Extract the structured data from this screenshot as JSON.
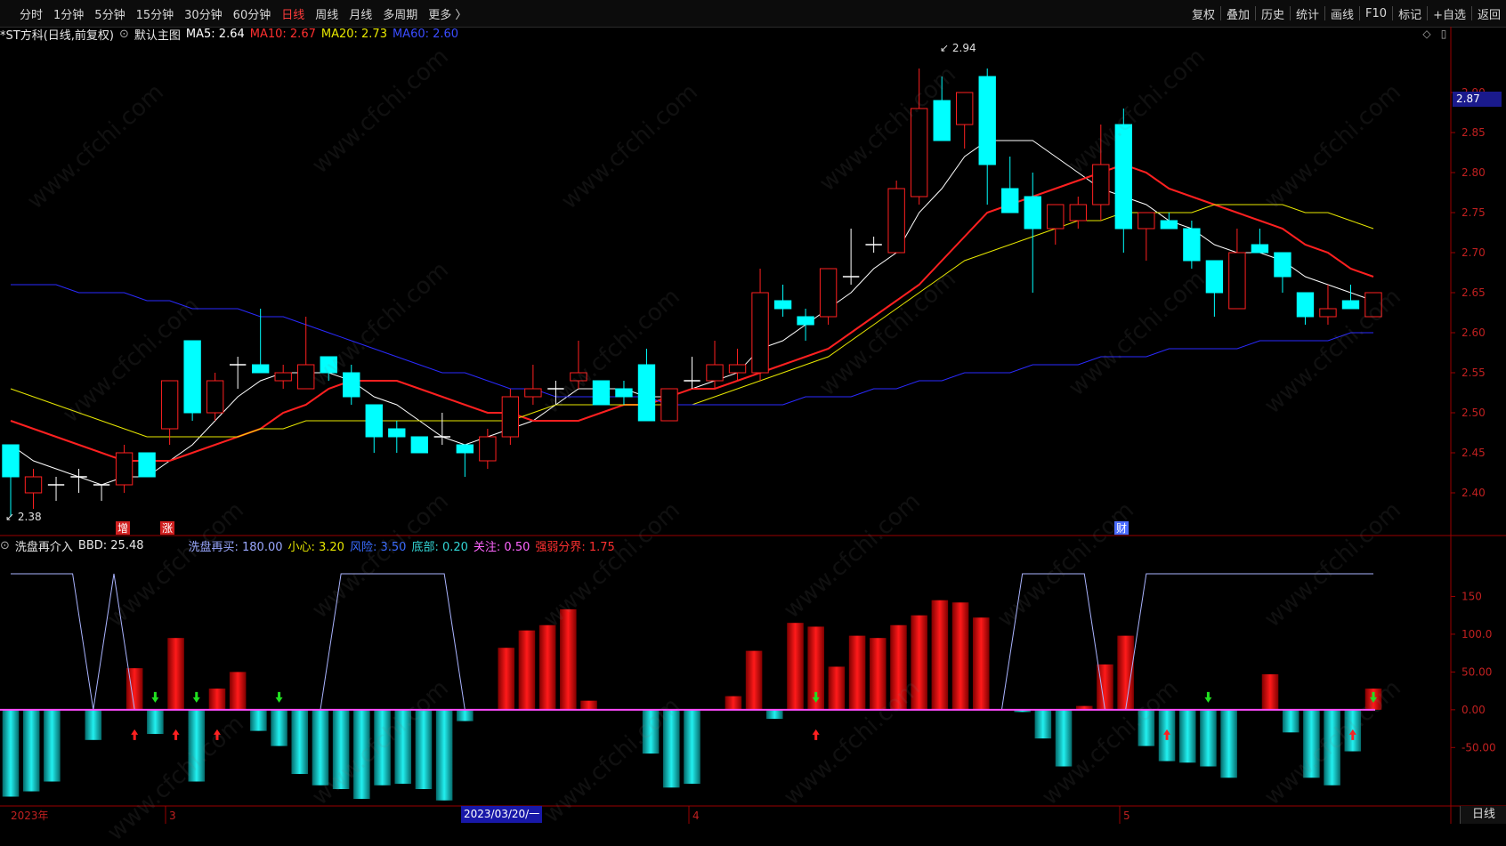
{
  "toolbar": {
    "periods": [
      "分时",
      "1分钟",
      "5分钟",
      "15分钟",
      "30分钟",
      "60分钟",
      "日线",
      "周线",
      "月线",
      "多周期",
      "更多 〉"
    ],
    "active_period": "日线",
    "right_buttons": [
      "复权",
      "叠加",
      "历史",
      "统计",
      "画线",
      "F10",
      "标记",
      "+自选",
      "返回"
    ]
  },
  "main_info": {
    "symbol": "*ST方科(日线,前复权)",
    "template": "默认主图",
    "ma5": {
      "label": "MA5: 2.64",
      "color": "#ffffff"
    },
    "ma10": {
      "label": "MA10: 2.67",
      "color": "#ff3030"
    },
    "ma20": {
      "label": "MA20: 2.73",
      "color": "#e8e800"
    },
    "ma60": {
      "label": "MA60: 2.60",
      "color": "#3030ff"
    }
  },
  "indicator_info": {
    "name": "洗盘再介入",
    "bbd": "BBD: 25.48",
    "items": [
      {
        "label": "洗盘再买: 180.00",
        "color": "#9aa8ff"
      },
      {
        "label": "小心: 3.20",
        "color": "#e8e800"
      },
      {
        "label": "风险: 3.50",
        "color": "#3a6cff"
      },
      {
        "label": "底部: 0.20",
        "color": "#33d6d6"
      },
      {
        "label": "关注: 0.50",
        "color": "#ff66ff"
      },
      {
        "label": "强弱分界: 1.75",
        "color": "#ff3030"
      }
    ]
  },
  "price_axis_labels": [
    "2.90",
    "2.85",
    "2.80",
    "2.75",
    "2.70",
    "2.65",
    "2.60",
    "2.55",
    "2.50",
    "2.45",
    "2.40"
  ],
  "ind_axis_labels": [
    "150",
    "100.0",
    "50.00",
    "0.00",
    "-50.00"
  ],
  "current_price": "2.87",
  "high_label": "2.94",
  "low_label": "2.38",
  "date_axis": {
    "year": "2023年",
    "m3": "3",
    "m4": "4",
    "m5": "5",
    "selected_date": "2023/03/20/一"
  },
  "event_markers": [
    "增",
    "涨",
    "财"
  ],
  "daily_button": "日线",
  "watermark": "www.cfchi.com",
  "colors": {
    "up": "#ff2020",
    "down": "#00ffff",
    "bar_up": "#d00000",
    "bar_down": "#10c0c0"
  },
  "chart_data": [
    {
      "type": "candlestick",
      "title": "*ST方科(日线,前复权)",
      "ylim": [
        2.36,
        2.96
      ],
      "candles": [
        [
          2.46,
          2.46,
          2.37,
          2.42
        ],
        [
          2.4,
          2.43,
          2.38,
          2.42
        ],
        [
          2.41,
          2.42,
          2.39,
          2.41
        ],
        [
          2.42,
          2.43,
          2.4,
          2.42
        ],
        [
          2.41,
          2.41,
          2.39,
          2.41
        ],
        [
          2.41,
          2.46,
          2.4,
          2.45
        ],
        [
          2.45,
          2.45,
          2.42,
          2.42
        ],
        [
          2.48,
          2.54,
          2.46,
          2.54
        ],
        [
          2.59,
          2.59,
          2.49,
          2.5
        ],
        [
          2.5,
          2.55,
          2.49,
          2.54
        ],
        [
          2.56,
          2.57,
          2.53,
          2.56
        ],
        [
          2.56,
          2.63,
          2.55,
          2.55
        ],
        [
          2.54,
          2.56,
          2.53,
          2.55
        ],
        [
          2.53,
          2.62,
          2.53,
          2.56
        ],
        [
          2.57,
          2.57,
          2.54,
          2.55
        ],
        [
          2.55,
          2.56,
          2.51,
          2.52
        ],
        [
          2.51,
          2.51,
          2.45,
          2.47
        ],
        [
          2.48,
          2.49,
          2.45,
          2.47
        ],
        [
          2.47,
          2.47,
          2.45,
          2.45
        ],
        [
          2.47,
          2.5,
          2.46,
          2.47
        ],
        [
          2.46,
          2.46,
          2.42,
          2.45
        ],
        [
          2.44,
          2.48,
          2.43,
          2.47
        ],
        [
          2.47,
          2.53,
          2.46,
          2.52
        ],
        [
          2.52,
          2.56,
          2.51,
          2.53
        ],
        [
          2.53,
          2.54,
          2.51,
          2.53
        ],
        [
          2.54,
          2.59,
          2.53,
          2.55
        ],
        [
          2.54,
          2.54,
          2.51,
          2.51
        ],
        [
          2.53,
          2.54,
          2.51,
          2.52
        ],
        [
          2.56,
          2.58,
          2.49,
          2.49
        ],
        [
          2.49,
          2.53,
          2.49,
          2.53
        ],
        [
          2.54,
          2.57,
          2.53,
          2.54
        ],
        [
          2.54,
          2.59,
          2.53,
          2.56
        ],
        [
          2.55,
          2.58,
          2.54,
          2.56
        ],
        [
          2.55,
          2.68,
          2.54,
          2.65
        ],
        [
          2.64,
          2.66,
          2.62,
          2.63
        ],
        [
          2.62,
          2.63,
          2.59,
          2.61
        ],
        [
          2.62,
          2.68,
          2.61,
          2.68
        ],
        [
          2.67,
          2.73,
          2.66,
          2.67
        ],
        [
          2.71,
          2.72,
          2.7,
          2.71
        ],
        [
          2.7,
          2.79,
          2.7,
          2.78
        ],
        [
          2.77,
          2.93,
          2.76,
          2.88
        ],
        [
          2.89,
          2.92,
          2.84,
          2.84
        ],
        [
          2.86,
          2.9,
          2.83,
          2.9
        ],
        [
          2.92,
          2.93,
          2.76,
          2.81
        ],
        [
          2.78,
          2.82,
          2.76,
          2.75
        ],
        [
          2.77,
          2.8,
          2.65,
          2.73
        ],
        [
          2.73,
          2.76,
          2.71,
          2.76
        ],
        [
          2.74,
          2.77,
          2.73,
          2.76
        ],
        [
          2.76,
          2.86,
          2.74,
          2.81
        ],
        [
          2.86,
          2.88,
          2.7,
          2.73
        ],
        [
          2.73,
          2.75,
          2.69,
          2.75
        ],
        [
          2.74,
          2.75,
          2.73,
          2.73
        ],
        [
          2.73,
          2.74,
          2.68,
          2.69
        ],
        [
          2.69,
          2.69,
          2.62,
          2.65
        ],
        [
          2.63,
          2.73,
          2.63,
          2.7
        ],
        [
          2.71,
          2.73,
          2.7,
          2.7
        ],
        [
          2.7,
          2.7,
          2.65,
          2.67
        ],
        [
          2.65,
          2.65,
          2.61,
          2.62
        ],
        [
          2.62,
          2.66,
          2.61,
          2.63
        ],
        [
          2.64,
          2.66,
          2.63,
          2.63
        ],
        [
          2.62,
          2.65,
          2.62,
          2.65
        ]
      ],
      "series": [
        {
          "name": "MA5",
          "values": [
            2.46,
            2.44,
            2.43,
            2.42,
            2.41,
            2.42,
            2.42,
            2.44,
            2.46,
            2.49,
            2.52,
            2.54,
            2.55,
            2.55,
            2.55,
            2.54,
            2.52,
            2.51,
            2.49,
            2.47,
            2.46,
            2.47,
            2.48,
            2.49,
            2.51,
            2.53,
            2.53,
            2.53,
            2.52,
            2.52,
            2.53,
            2.54,
            2.55,
            2.58,
            2.59,
            2.61,
            2.63,
            2.65,
            2.68,
            2.7,
            2.75,
            2.78,
            2.82,
            2.84,
            2.84,
            2.84,
            2.82,
            2.8,
            2.78,
            2.77,
            2.76,
            2.74,
            2.73,
            2.71,
            2.7,
            2.7,
            2.69,
            2.67,
            2.66,
            2.65,
            2.64
          ]
        },
        {
          "name": "MA10",
          "values": [
            2.49,
            2.48,
            2.47,
            2.46,
            2.45,
            2.44,
            2.44,
            2.44,
            2.45,
            2.46,
            2.47,
            2.48,
            2.5,
            2.51,
            2.53,
            2.54,
            2.54,
            2.54,
            2.53,
            2.52,
            2.51,
            2.5,
            2.5,
            2.49,
            2.49,
            2.49,
            2.5,
            2.51,
            2.51,
            2.52,
            2.53,
            2.53,
            2.54,
            2.55,
            2.56,
            2.57,
            2.58,
            2.6,
            2.62,
            2.64,
            2.66,
            2.69,
            2.72,
            2.75,
            2.76,
            2.77,
            2.78,
            2.79,
            2.8,
            2.81,
            2.8,
            2.78,
            2.77,
            2.76,
            2.75,
            2.74,
            2.73,
            2.71,
            2.7,
            2.68,
            2.67
          ]
        },
        {
          "name": "MA20",
          "values": [
            2.53,
            2.52,
            2.51,
            2.5,
            2.49,
            2.48,
            2.47,
            2.47,
            2.47,
            2.47,
            2.47,
            2.48,
            2.48,
            2.49,
            2.49,
            2.49,
            2.49,
            2.49,
            2.49,
            2.49,
            2.49,
            2.49,
            2.49,
            2.5,
            2.51,
            2.51,
            2.51,
            2.51,
            2.51,
            2.51,
            2.51,
            2.52,
            2.53,
            2.54,
            2.55,
            2.56,
            2.57,
            2.59,
            2.61,
            2.63,
            2.65,
            2.67,
            2.69,
            2.7,
            2.71,
            2.72,
            2.73,
            2.74,
            2.74,
            2.75,
            2.75,
            2.75,
            2.75,
            2.76,
            2.76,
            2.76,
            2.76,
            2.75,
            2.75,
            2.74,
            2.73
          ]
        },
        {
          "name": "MA60",
          "values": [
            2.66,
            2.66,
            2.66,
            2.65,
            2.65,
            2.65,
            2.64,
            2.64,
            2.63,
            2.63,
            2.63,
            2.62,
            2.62,
            2.61,
            2.6,
            2.59,
            2.58,
            2.57,
            2.56,
            2.55,
            2.55,
            2.54,
            2.53,
            2.53,
            2.52,
            2.52,
            2.52,
            2.52,
            2.52,
            2.51,
            2.51,
            2.51,
            2.51,
            2.51,
            2.51,
            2.52,
            2.52,
            2.52,
            2.53,
            2.53,
            2.54,
            2.54,
            2.55,
            2.55,
            2.55,
            2.56,
            2.56,
            2.56,
            2.57,
            2.57,
            2.57,
            2.58,
            2.58,
            2.58,
            2.58,
            2.59,
            2.59,
            2.59,
            2.59,
            2.6,
            2.6
          ]
        }
      ]
    },
    {
      "type": "bar",
      "title": "洗盘再介入",
      "ylim": [
        -125,
        200
      ],
      "values": [
        -115,
        -108,
        -95,
        0,
        -40,
        0,
        55,
        -32,
        95,
        -95,
        28,
        50,
        -28,
        -48,
        -85,
        -100,
        -105,
        -118,
        -100,
        -98,
        -105,
        -120,
        -15,
        0,
        82,
        105,
        112,
        133,
        12,
        0,
        0,
        -58,
        -103,
        -98,
        0,
        18,
        78,
        -12,
        115,
        110,
        57,
        98,
        95,
        112,
        125,
        145,
        142,
        122,
        0,
        -3,
        -38,
        -75,
        5,
        60,
        98,
        -48,
        -68,
        -70,
        -75,
        -90,
        0,
        47,
        -30,
        -90,
        -100,
        -55,
        28
      ],
      "series": [
        {
          "name": "洗盘再买",
          "values": [
            180,
            180,
            180,
            180,
            0,
            180,
            0,
            0,
            0,
            0,
            0,
            0,
            0,
            0,
            0,
            0,
            180,
            180,
            180,
            180,
            180,
            180,
            0,
            0,
            0,
            0,
            0,
            0,
            0,
            0,
            0,
            0,
            0,
            0,
            0,
            0,
            0,
            0,
            0,
            0,
            0,
            0,
            0,
            0,
            0,
            0,
            0,
            0,
            0,
            180,
            180,
            180,
            180,
            0,
            0,
            180,
            180,
            180,
            180,
            180,
            180,
            180,
            180,
            180,
            180,
            180,
            180,
            180,
            180,
            180
          ]
        },
        {
          "name": "关注",
          "values": [
            0.5
          ]
        }
      ],
      "green_down_arrows": [
        7,
        9,
        13,
        39,
        58,
        66
      ],
      "red_up_arrows": [
        6,
        8,
        10,
        39,
        56,
        65
      ]
    }
  ]
}
